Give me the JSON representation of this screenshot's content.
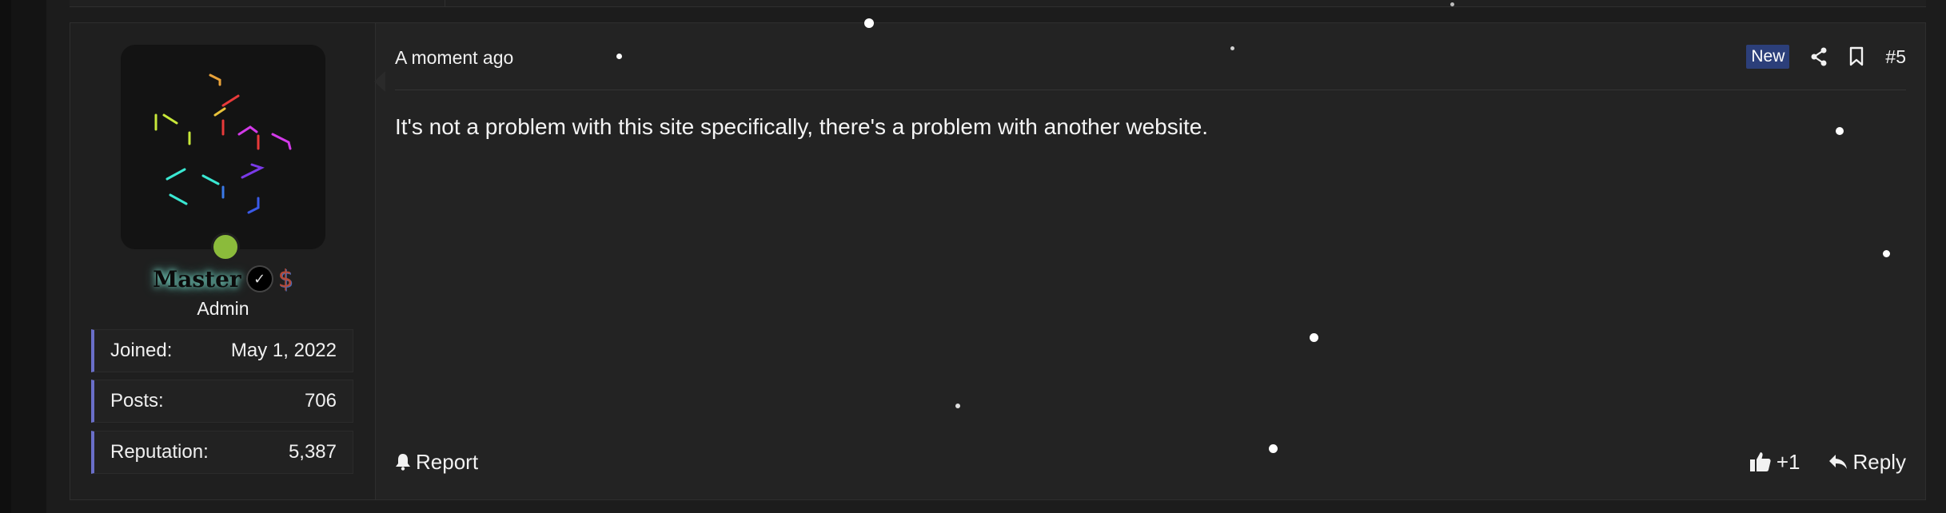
{
  "post": {
    "date": "A moment ago",
    "badge": "New",
    "number": "#5",
    "message": "It's not a problem with this site specifically, there's a problem with another website.",
    "footer": {
      "report_label": "Report",
      "like_label": "+1",
      "reply_label": "Reply"
    }
  },
  "user": {
    "username": "Master",
    "role": "Admin",
    "online": true,
    "stats": [
      {
        "label": "Joined:",
        "value": "May 1, 2022"
      },
      {
        "label": "Posts:",
        "value": "706"
      },
      {
        "label": "Reputation:",
        "value": "5,387"
      }
    ]
  },
  "icons": {
    "share": "share-icon",
    "bookmark": "bookmark-icon",
    "report": "bell-icon",
    "like": "thumbs-up-icon",
    "reply": "reply-icon",
    "verified": "check-badge-icon",
    "dollar": "dollar-icon"
  },
  "colors": {
    "background": "#1c1c1c",
    "post_background": "#232323",
    "accent_stat_border": "#6a6fc9",
    "badge_new": "#2c3f7a",
    "online": "#8bbb3b",
    "username_glow": "#7fd8c8"
  }
}
